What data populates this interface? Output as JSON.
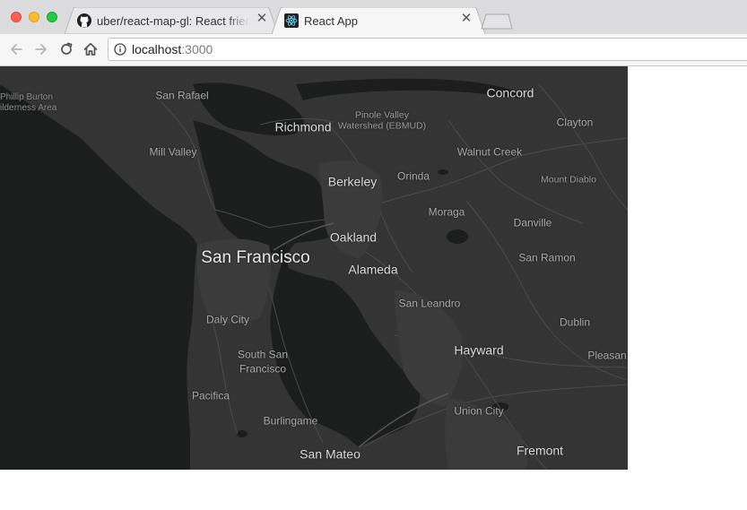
{
  "browser": {
    "tabs": [
      {
        "title": "uber/react-map-gl: React friendly API wrapper around MapboxGL",
        "favicon": "github-icon",
        "active": false
      },
      {
        "title": "React App",
        "favicon": "react-icon",
        "active": true
      }
    ],
    "address": {
      "host": "localhost",
      "port": ":3000"
    },
    "colors": {
      "tabstrip": "#dcdcde",
      "toolbar": "#f6f6f6"
    }
  },
  "map": {
    "style": "dark",
    "colors": {
      "water": "#1a1a1a",
      "land": "#343434",
      "roads": "#4a4a4a",
      "labels": "#e6e6e6"
    },
    "labels": {
      "san_francisco": "San Francisco",
      "oakland": "Oakland",
      "berkeley": "Berkeley",
      "richmond": "Richmond",
      "alameda": "Alameda",
      "concord": "Concord",
      "hayward": "Hayward",
      "san_mateo": "San Mateo",
      "fremont": "Fremont",
      "san_rafael": "San Rafael",
      "mill_valley": "Mill Valley",
      "pinole_valley_1": "Pinole Valley",
      "pinole_valley_2": "Watershed (EBMUD)",
      "clayton": "Clayton",
      "walnut_creek": "Walnut Creek",
      "orinda": "Orinda",
      "mount_diablo": "Mount Diablo",
      "moraga": "Moraga",
      "danville": "Danville",
      "san_ramon": "San Ramon",
      "san_leandro": "San Leandro",
      "daly_city": "Daly City",
      "south_sf_1": "South San",
      "south_sf_2": "Francisco",
      "dublin": "Dublin",
      "pleasanton": "Pleasan",
      "pacifica": "Pacifica",
      "union_city": "Union City",
      "burlingame": "Burlingame",
      "phillip_burton_1": "Phillip Burton",
      "phillip_burton_2": "ilderness Area"
    }
  }
}
